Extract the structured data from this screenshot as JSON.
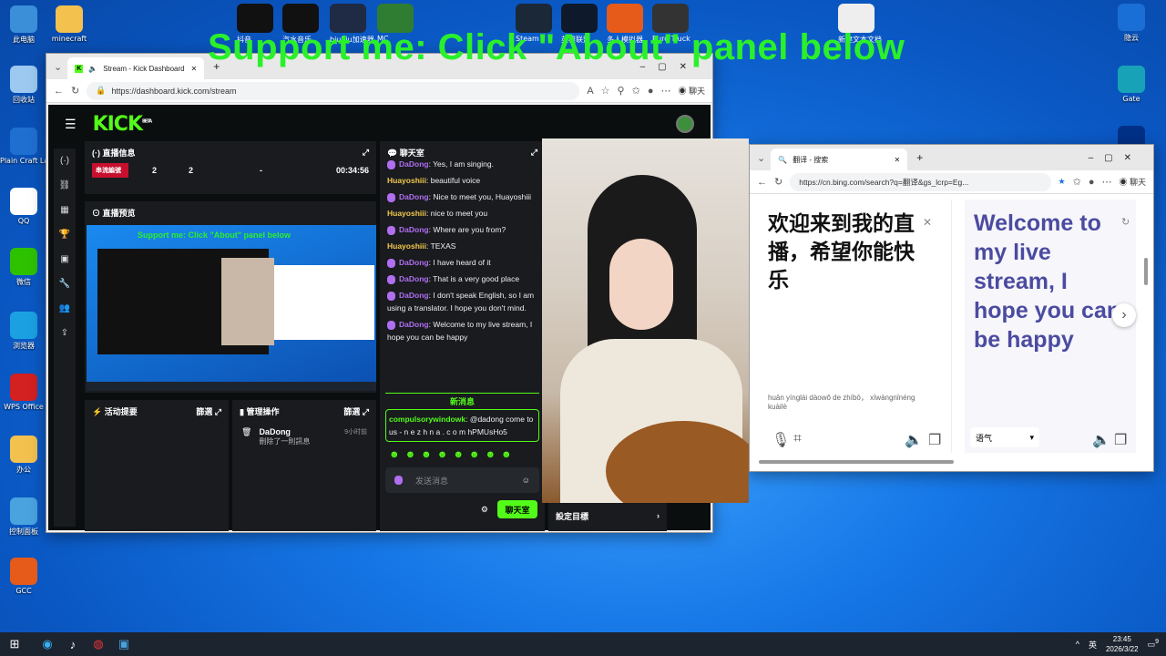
{
  "banner": "Support me: Click \"About\" panel below",
  "desktop_left": [
    {
      "label": "此电脑",
      "icon": "computer-icon",
      "color": "#3a8fd8"
    },
    {
      "label": "minecraft",
      "icon": "folder-icon",
      "color": "#f2c14e"
    },
    {
      "label": "回收站",
      "icon": "recycle-bin-icon",
      "color": "#9cc9f0"
    },
    {
      "label": "Plain Craft Launcher",
      "icon": "pcl-icon",
      "color": "#1f6fd1"
    },
    {
      "label": "QQ",
      "icon": "qq-icon",
      "color": "#ffffff"
    },
    {
      "label": "微信",
      "icon": "wechat-icon",
      "color": "#2dc100"
    },
    {
      "label": "浏览器",
      "icon": "edge-icon",
      "color": "#1ba1e2"
    },
    {
      "label": "WPS Office",
      "icon": "wps-icon",
      "color": "#d32020"
    },
    {
      "label": "办公",
      "icon": "folder-icon",
      "color": "#f2c14e"
    },
    {
      "label": "控制面板",
      "icon": "control-panel-icon",
      "color": "#4aa3df"
    },
    {
      "label": "GCC",
      "icon": "gcc-icon",
      "color": "#e65a1a"
    }
  ],
  "desktop_top": [
    {
      "label": "抖音",
      "icon": "douyin-icon",
      "color": "#111111"
    },
    {
      "label": "汽水音乐",
      "icon": "music-icon",
      "color": "#111111"
    },
    {
      "label": "biubiu加速器",
      "icon": "biubiu-icon",
      "color": "#1f2a44"
    },
    {
      "label": "MC",
      "icon": "mc-icon",
      "color": "#2f7d32"
    },
    {
      "label": "Steam",
      "icon": "steam-icon",
      "color": "#1b2838"
    },
    {
      "label": "英雄联盟",
      "icon": "lol-icon",
      "color": "#0e1a2b"
    },
    {
      "label": "多人模拟器",
      "icon": "emulator-icon",
      "color": "#e65a1a"
    },
    {
      "label": "Euro Truck",
      "icon": "truck-icon",
      "color": "#333333"
    },
    {
      "label": "新建文本文档",
      "icon": "text-file-icon",
      "color": "#eeeeee"
    }
  ],
  "desktop_right": [
    {
      "label": "隐云",
      "icon": "cloud-icon",
      "color": "#1a6fd6"
    },
    {
      "label": "Gate",
      "icon": "gate-icon",
      "color": "#17a2b8"
    },
    {
      "label": "PayPal",
      "icon": "paypal-icon",
      "color": "#003087"
    }
  ],
  "browser1": {
    "tab_title": "Stream - Kick Dashboard",
    "url": "https://dashboard.kick.com/stream",
    "chat_btn": "聊天"
  },
  "kick": {
    "logo": "KICK",
    "logo_badge": "BETA",
    "stream_info": {
      "title": "直播信息",
      "badge": "串流編號",
      "stats": [
        "2",
        "2",
        "-",
        "00:34:56"
      ]
    },
    "preview": {
      "title": "直播预览",
      "overlay": "Support me: Click \"About\" panel below"
    },
    "chat": {
      "title": "聊天室",
      "messages": [
        {
          "user": "DaDong",
          "text": "Yes, I am singing.",
          "type": "g",
          "mic": true
        },
        {
          "user": "Huayoshiii",
          "text": "beautiful voice",
          "type": "y",
          "mic": false
        },
        {
          "user": "DaDong",
          "text": "Nice to meet you, Huayoshiii",
          "type": "g",
          "mic": true
        },
        {
          "user": "Huayoshiii",
          "text": "nice to meet you",
          "type": "y",
          "mic": false
        },
        {
          "user": "DaDong",
          "text": "Where are you from?",
          "type": "g",
          "mic": true
        },
        {
          "user": "Huayoshiii",
          "text": "TEXAS",
          "type": "y",
          "mic": false
        },
        {
          "user": "DaDong",
          "text": "I have heard of it",
          "type": "g",
          "mic": true
        },
        {
          "user": "DaDong",
          "text": "That is a very good place",
          "type": "g",
          "mic": true
        },
        {
          "user": "DaDong",
          "text": "I don't speak English, so I am using a translator. I hope you don't mind.",
          "type": "g",
          "mic": true
        },
        {
          "user": "DaDong",
          "text": "Welcome to my live stream, I hope you can be happy",
          "type": "g",
          "mic": true
        }
      ],
      "new_msg": "新消息",
      "spam_user": "compulsorywindowk",
      "spam_text": "@dadong come to us - n e z h n a . c o m hPMUsHo5",
      "placeholder": "发送消息",
      "send": "聊天室"
    },
    "activity": {
      "title": "活动提要",
      "filter": "篩選"
    },
    "mod": {
      "title": "管理操作",
      "filter": "篩選",
      "user": "DaDong",
      "time": "9小时前",
      "action": "刪除了一則訊息"
    },
    "goal": {
      "title": "設定目標"
    }
  },
  "browser2": {
    "tab_title": "翻译 - 搜索",
    "url": "https://cn.bing.com/search?q=翻译&gs_lcrp=Eg...",
    "chat_btn": "聊天",
    "source": "欢迎来到我的直播，希望你能快乐",
    "pinyin": "huān yínglái dàowǒ de zhíbō， xīwàngnǐnéng kuàilè",
    "target": "Welcome to my live stream, I hope you can be happy",
    "tone": "语气"
  },
  "taskbar": {
    "ime": "英",
    "time": "23:45",
    "date": "2026/3/22",
    "notif": "9"
  }
}
